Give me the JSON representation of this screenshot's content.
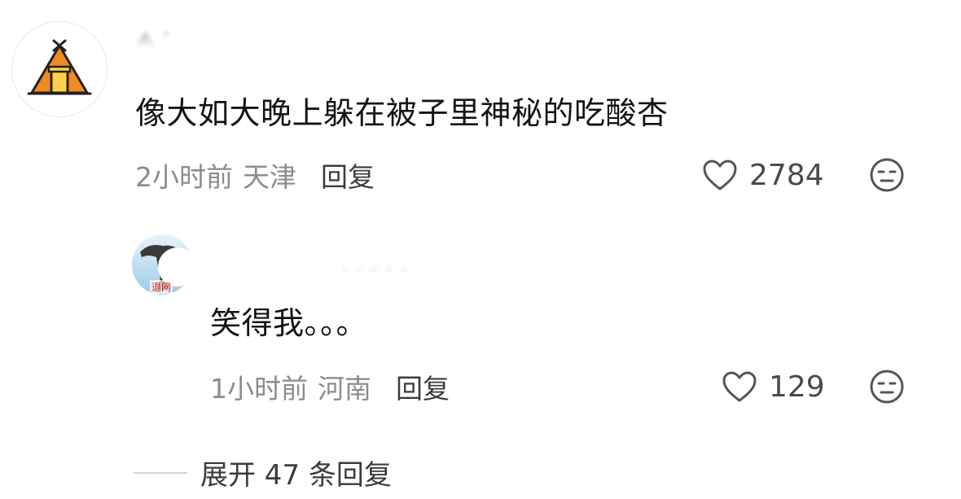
{
  "comments": [
    {
      "avatar_icon": "tent-avatar-icon",
      "username": "ᗑ ᐪ",
      "text": "像大如大晚上躲在被子里神秘的吃酸杏",
      "time": "2小时前",
      "location": "天津",
      "reply_label": "回复",
      "likes": "2784",
      "like_icon": "heart-outline-icon",
      "emoji_icon": "neutral-face-icon"
    },
    {
      "avatar_icon": "statue-avatar-icon",
      "avatar_badge": "退网",
      "username": "· · ·  · ·",
      "text": "笑得我。。。",
      "time": "1小时前",
      "location": "河南",
      "reply_label": "回复",
      "likes": "129",
      "like_icon": "heart-outline-icon",
      "emoji_icon": "neutral-face-icon"
    }
  ],
  "expand": {
    "label": "展开 47 条回复"
  },
  "colors": {
    "text_primary": "#141414",
    "text_secondary": "#8c8c8c",
    "tent_orange": "#f08a24",
    "tent_yellow": "#ffd14a"
  }
}
